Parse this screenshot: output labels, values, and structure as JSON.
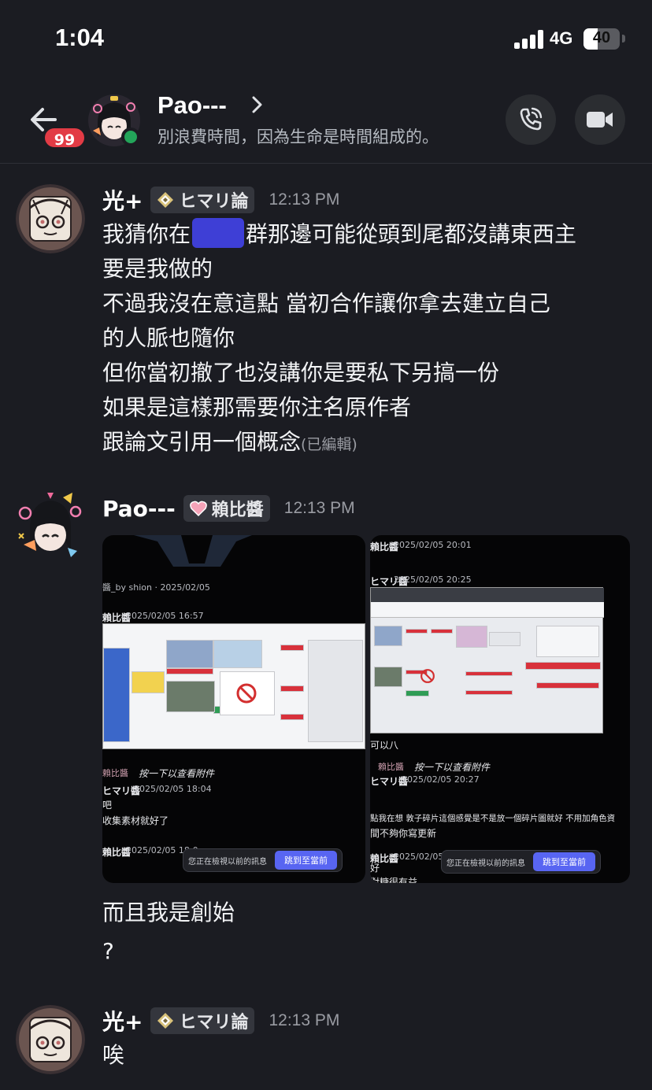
{
  "status_bar": {
    "time": "1:04",
    "network": "4G",
    "battery": "40",
    "battery_level": 0.4
  },
  "header": {
    "back_badge": "99",
    "name": "Pao---",
    "status": "別浪費時間，因為生命是時間組成的。"
  },
  "messages": [
    {
      "author": "光+",
      "tag": "ヒマリ論",
      "time": "12:13 PM",
      "lines": {
        "l1a": "我猜你在",
        "l1b": "群那邊可能從頭到尾都沒講東西主",
        "l2": "要是我做的",
        "l3": "不過我沒在意這點 當初合作讓你拿去建立自己",
        "l4": "的人脈也隨你",
        "l5": "但你當初撤了也沒講你是要私下另搞一份",
        "l6": "如果是這樣那需要你注名原作者",
        "l7": "跟論文引用一個概念"
      },
      "edited": "(已編輯)"
    },
    {
      "author": "Pao---",
      "tag": "賴比醬",
      "time": "12:13 PM",
      "attachment_a": {
        "header_label": "醬_by shion · 2025/02/05",
        "row1_name": "賴比醬",
        "row1_time": "2025/02/05 16:57",
        "reply_label": "賴比醬",
        "reply_text": "按一下以查看附件",
        "row2_name": "ヒマリ醬",
        "row2_time": "2025/02/05 18:04",
        "line_a": "吧",
        "line_b": "收集素材就好了",
        "row3_name": "賴比醬",
        "row3_time": "2025/02/05 18:0",
        "pill_text": "您正在檢視以前的訊息",
        "pill_button": "跳到至當前"
      },
      "attachment_b": {
        "row0_name": "賴比醬",
        "row0_time": "2025/02/05 20:01",
        "row1_name": "ヒマリ醬",
        "row1_time": "2025/02/05 20:25",
        "line_a": "可以八",
        "reply_label": "賴比醬",
        "reply_text": "按一下以查看附件",
        "row2_name": "ヒマリ醬",
        "row2_time": "2025/02/05 20:27",
        "line_b": "點我在想 敦子碎片這個感覺是不是放一個碎片圖就好 不用加角色資",
        "line_c": "間不夠你寫更新",
        "row3_name": "賴比醬",
        "row3_time": "2025/02/05 20:2",
        "line_d": "好",
        "line_e": "對糖很有益",
        "pill_text": "您正在檢視以前的訊息",
        "pill_button": "跳到至當前"
      },
      "texts": [
        "而且我是創始",
        "?"
      ]
    },
    {
      "author": "光+",
      "tag": "ヒマリ論",
      "time": "12:13 PM",
      "text": "唉"
    }
  ]
}
